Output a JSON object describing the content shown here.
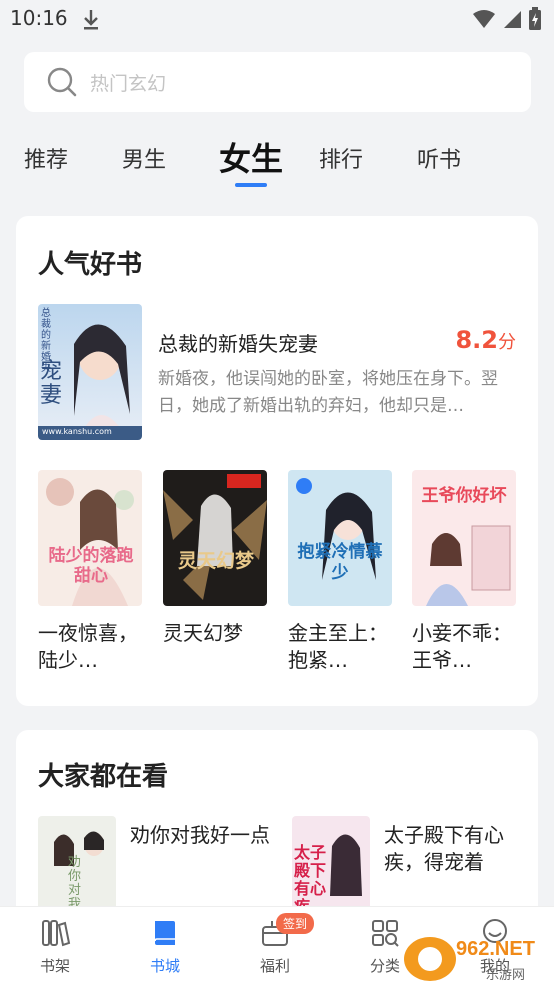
{
  "status_bar": {
    "time": "10:16"
  },
  "search": {
    "placeholder": "热门玄幻"
  },
  "tabs": [
    {
      "label": "推荐"
    },
    {
      "label": "男生"
    },
    {
      "label": "女生",
      "active": true
    },
    {
      "label": "排行"
    },
    {
      "label": "听书"
    }
  ],
  "popular": {
    "title": "人气好书",
    "featured": {
      "title": "总裁的新婚失宠妻",
      "score": "8.2",
      "score_unit": "分",
      "description": "新婚夜，他误闯她的卧室，将她压在身下。翌日，她成了新婚出轨的弃妇，他却只是…",
      "cover_text": "宠妻",
      "cover_small": "总裁的新婚失",
      "cover_site": "www.kanshu.com"
    },
    "books": [
      {
        "title": "一夜惊喜，陆少…",
        "cover_text": "陆少的落跑甜心"
      },
      {
        "title": "灵天幻梦",
        "cover_text": "灵天幻梦"
      },
      {
        "title": "金主至上：抱紧…",
        "cover_text": "抱紧冷情慕少"
      },
      {
        "title": "小妾不乖：王爷…",
        "cover_text": "王爷你好坏"
      }
    ]
  },
  "watching": {
    "title": "大家都在看",
    "books": [
      {
        "title": "劝你对我好一点",
        "cover_text": "劝你对我好一点"
      },
      {
        "title": "太子殿下有心疾，得宠着",
        "cover_text": "太子殿下有心疾"
      }
    ]
  },
  "bottom_nav": {
    "items": [
      {
        "label": "书架"
      },
      {
        "label": "书城",
        "active": true
      },
      {
        "label": "福利",
        "badge": "签到"
      },
      {
        "label": "分类"
      },
      {
        "label": "我的"
      }
    ]
  },
  "watermark": {
    "text": "962.NET",
    "sub": "乐游网"
  },
  "colors": {
    "accent": "#2f7df6",
    "score": "#f0533c",
    "badge": "#f26a4a"
  }
}
